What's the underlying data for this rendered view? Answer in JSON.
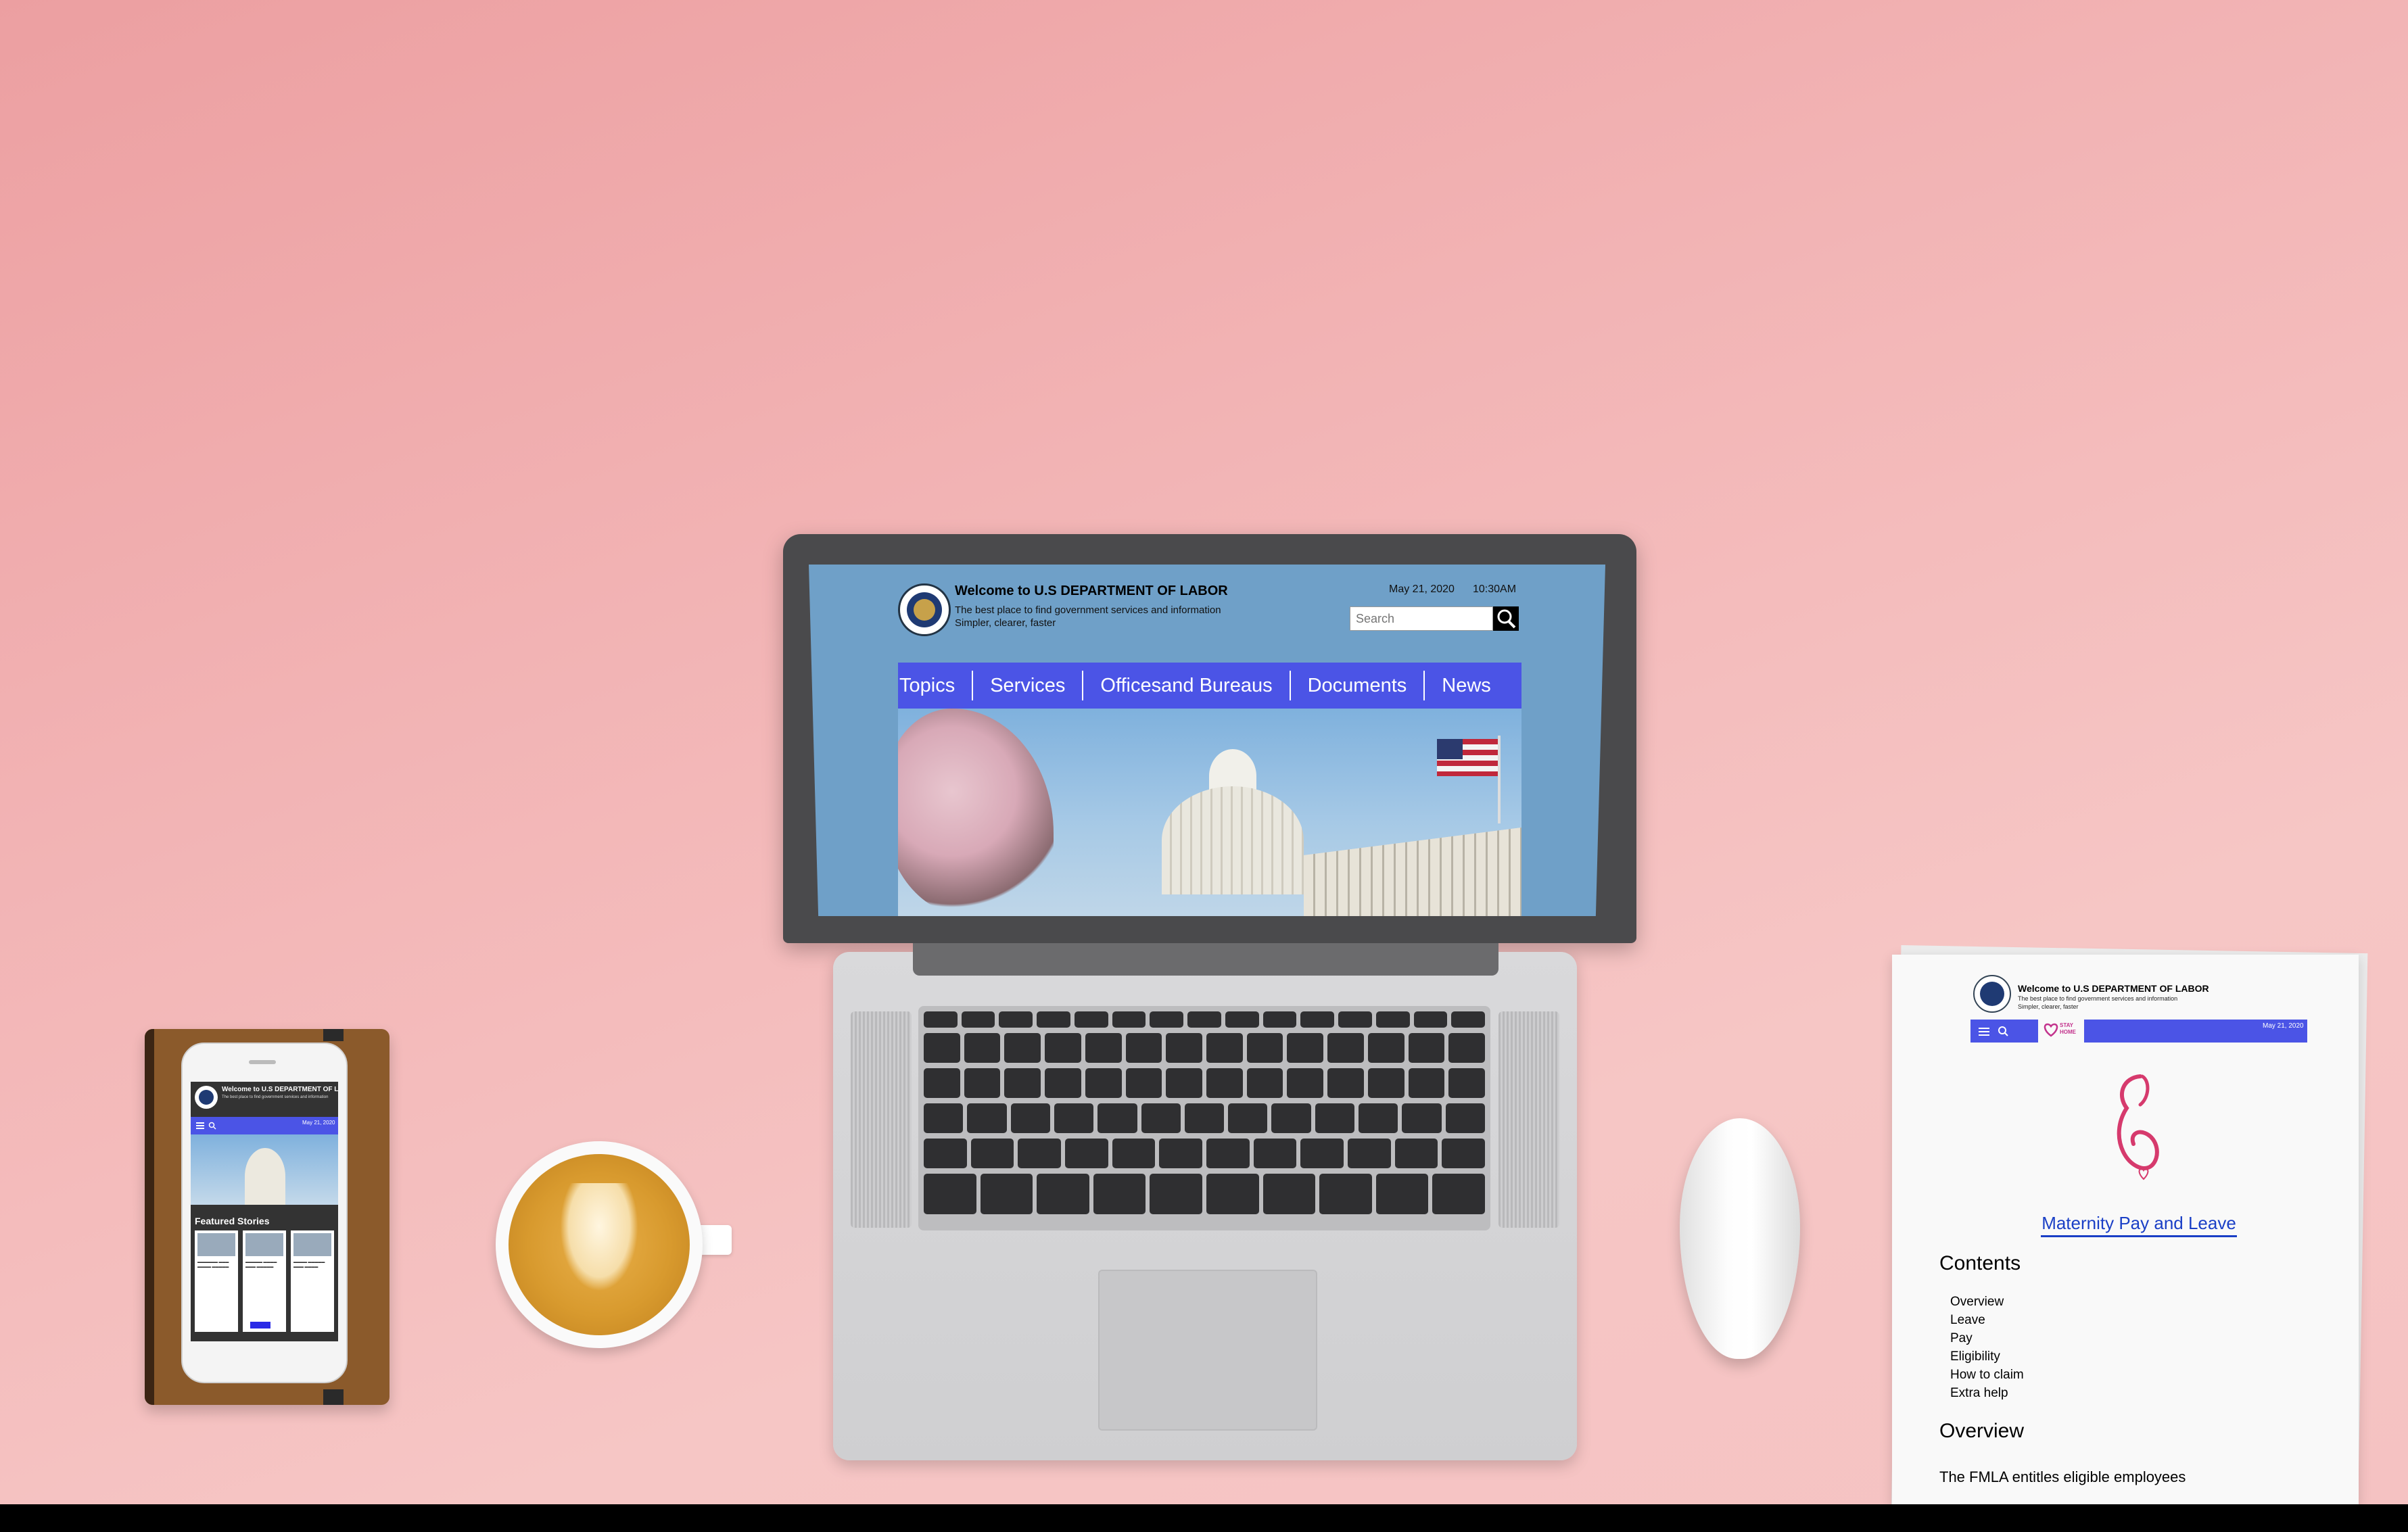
{
  "laptop_site": {
    "title": "Welcome to U.S DEPARTMENT OF LABOR",
    "subtitle_line1": "The best place to find government services and information",
    "subtitle_line2": "Simpler, clearer, faster",
    "date": "May 21, 2020",
    "time": "10:30AM",
    "search_placeholder": "Search",
    "nav": [
      "Topics",
      "Services",
      "Officesand Bureaus",
      "Documents",
      "News"
    ]
  },
  "phone_site": {
    "title": "Welcome to U.S DEPARTMENT OF LABOR",
    "subtitle": "The best place to find government services and information",
    "date": "May 21, 2020",
    "featured_heading": "Featured Stories"
  },
  "paper_site": {
    "title": "Welcome to U.S DEPARTMENT OF LABOR",
    "subtitle_line1": "The best place to find government services and information",
    "subtitle_line2": "Simpler, clearer, faster",
    "date": "May 21, 2020",
    "stay_home_label": "STAY HOME",
    "heading": "Maternity Pay and Leave",
    "contents_title": "Contents",
    "contents": [
      "Overview",
      "Leave",
      "Pay",
      "Eligibility",
      "How to claim",
      "Extra help"
    ],
    "overview_title": "Overview",
    "body_text": "The FMLA entitles eligible employees"
  },
  "colors": {
    "nav_blue": "#4b54e6",
    "link_blue": "#1a3fc6",
    "background_pink": "#f2b3b4"
  }
}
